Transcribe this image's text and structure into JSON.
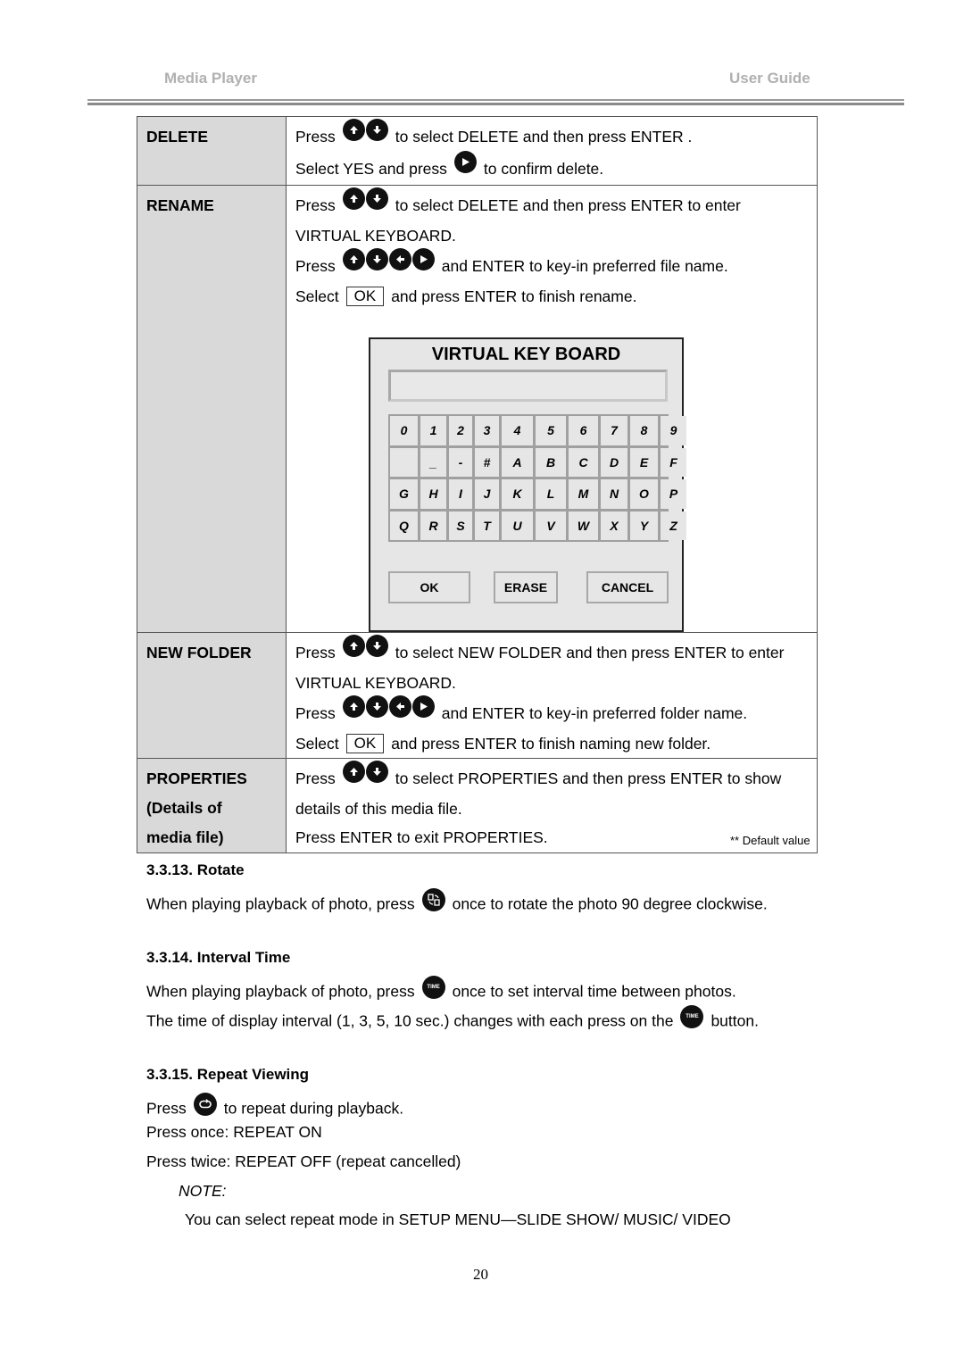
{
  "header": {
    "left": "Media  Player",
    "right": "User  Guide"
  },
  "table": {
    "rows": [
      {
        "label": [
          "DELETE"
        ],
        "lines": [
          {
            "before": "Press",
            "icons": [
              "up-arrow",
              "down-arrow"
            ],
            "after": "to select DELETE and then press ENTER ."
          },
          {
            "before": "Select YES and press",
            "icons": [
              "right-arrow"
            ],
            "after": "to confirm delete."
          }
        ]
      },
      {
        "label": [
          "RENAME"
        ],
        "lines": [
          {
            "before": "Press",
            "icons": [
              "up-arrow",
              "down-arrow"
            ],
            "after": "to select DELETE and then press ENTER to enter"
          },
          {
            "text": "VIRTUAL KEYBOARD."
          },
          {
            "before": "Press",
            "icons": [
              "up-arrow",
              "down-arrow",
              "left-arrow",
              "right-arrow"
            ],
            "after": "and ENTER to key-in preferred file name."
          },
          {
            "before": "Select",
            "box": "OK",
            "after": "and press ENTER to finish rename."
          }
        ]
      },
      {
        "label": [
          "NEW FOLDER"
        ],
        "lines": [
          {
            "before": "Press",
            "icons": [
              "up-arrow",
              "down-arrow"
            ],
            "after": "to select NEW FOLDER and then press ENTER to enter"
          },
          {
            "text": "VIRTUAL KEYBOARD."
          },
          {
            "before": "Press",
            "icons": [
              "up-arrow",
              "down-arrow",
              "left-arrow",
              "right-arrow"
            ],
            "after": "and ENTER to key-in preferred folder name."
          },
          {
            "before": "Select",
            "box": "OK",
            "after": "and press ENTER to finish naming new folder."
          }
        ]
      },
      {
        "label": [
          "PROPERTIES",
          "(Details of",
          "media file)"
        ],
        "lines": [
          {
            "before": "Press",
            "icons": [
              "up-arrow",
              "down-arrow"
            ],
            "after": "to select PROPERTIES and then press ENTER to show"
          },
          {
            "text": "details of this media file."
          },
          {
            "text": "Press ENTER to exit PROPERTIES."
          }
        ]
      }
    ]
  },
  "keyboard": {
    "title": "VIRTUAL KEY BOARD",
    "input_value": "",
    "keys": [
      "0",
      "1",
      "2",
      "3",
      "4",
      "5",
      "6",
      "7",
      "8",
      "9",
      "",
      "_",
      "-",
      "#",
      "A",
      "B",
      "C",
      "D",
      "E",
      "F",
      "G",
      "H",
      "I",
      "J",
      "K",
      "L",
      "M",
      "N",
      "O",
      "P",
      "Q",
      "R",
      "S",
      "T",
      "U",
      "V",
      "W",
      "X",
      "Y",
      "Z"
    ],
    "buttons": {
      "ok": "OK",
      "erase": "ERASE",
      "cancel": "CANCEL"
    }
  },
  "default_note": "** Default value",
  "sections": {
    "rotate": {
      "heading": "3.3.13. Rotate",
      "before": "When playing playback of photo, press",
      "after": "once to rotate the photo 90 degree clockwise."
    },
    "interval": {
      "heading": "3.3.14. Interval Time",
      "line1_before": "When playing playback of photo, press",
      "line1_after": "once to set interval time between photos.",
      "line2_before": "The time of display interval (1, 3, 5, 10 sec.) changes with each press on the",
      "line2_after": "button.",
      "icon_label": "TIME"
    },
    "repeat": {
      "heading": "3.3.15. Repeat Viewing",
      "line1_before": "Press",
      "line1_after": "to repeat during playback.",
      "line2": "Press once: REPEAT ON",
      "line3": "Press twice: REPEAT OFF (repeat cancelled)",
      "note_label": "NOTE:",
      "note_text": "You can select repeat mode in SETUP MENU—SLIDE SHOW/ MUSIC/ VIDEO"
    }
  },
  "page_number": "20"
}
